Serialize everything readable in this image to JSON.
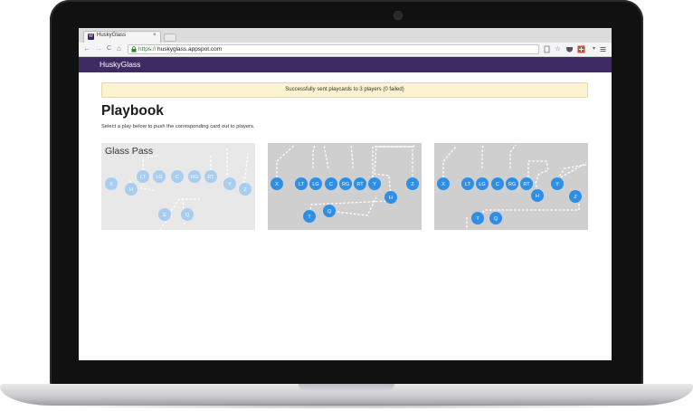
{
  "browser": {
    "tab_title": "HuskyGlass",
    "tab_favicon": "W",
    "tab_close": "×",
    "url_scheme": "https://",
    "url_host": "huskyglass.appspot.com",
    "nav": {
      "back": "←",
      "forward": "→",
      "reload": "C",
      "home": "⌂"
    },
    "toolbar_icons": [
      "page-icon",
      "star-icon",
      "pocket-icon",
      "extension-icon",
      "menu-icon"
    ]
  },
  "app": {
    "brand": "HuskyGlass",
    "alert": "Successfully sent playcards to 3 players (0 failed)",
    "title": "Playbook",
    "description": "Select a play below to push the corresponding card out to players."
  },
  "plays": [
    {
      "label": "Glass Pass",
      "players": [
        "X",
        "H",
        "LT",
        "LG",
        "C",
        "RG",
        "RT",
        "Y",
        "Z",
        "E",
        "Q"
      ]
    },
    {
      "label": "",
      "players": [
        "X",
        "LT",
        "LG",
        "C",
        "RG",
        "RT",
        "Y",
        "Z",
        "H",
        "T",
        "Q"
      ]
    },
    {
      "label": "",
      "players": [
        "X",
        "LT",
        "LG",
        "C",
        "RG",
        "RT",
        "Y",
        "Z",
        "H",
        "T",
        "Q"
      ]
    }
  ],
  "colors": {
    "header": "#3d2b63",
    "player_active": "#2f8fe6",
    "player_faded": "#a9cdf0",
    "alert_bg": "#fcf3cf"
  }
}
